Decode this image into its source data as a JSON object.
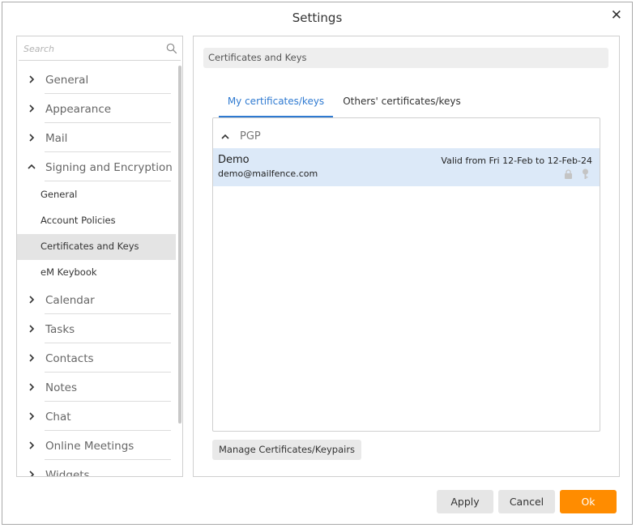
{
  "window": {
    "title": "Settings"
  },
  "sidebar": {
    "search_placeholder": "Search",
    "items": [
      {
        "label": "General",
        "expanded": false
      },
      {
        "label": "Appearance",
        "expanded": false
      },
      {
        "label": "Mail",
        "expanded": false
      },
      {
        "label": "Signing and Encryption",
        "expanded": true,
        "children": [
          {
            "label": "General"
          },
          {
            "label": "Account Policies"
          },
          {
            "label": "Certificates and Keys",
            "selected": true
          },
          {
            "label": "eM Keybook"
          }
        ]
      },
      {
        "label": "Calendar",
        "expanded": false
      },
      {
        "label": "Tasks",
        "expanded": false
      },
      {
        "label": "Contacts",
        "expanded": false
      },
      {
        "label": "Notes",
        "expanded": false
      },
      {
        "label": "Chat",
        "expanded": false
      },
      {
        "label": "Online Meetings",
        "expanded": false
      },
      {
        "label": "Widgets",
        "expanded": false
      }
    ]
  },
  "main": {
    "section_title": "Certificates and Keys",
    "tabs": [
      {
        "label": "My certificates/keys",
        "active": true
      },
      {
        "label": "Others' certificates/keys",
        "active": false
      }
    ],
    "group": {
      "label": "PGP",
      "expanded": true
    },
    "certificates": [
      {
        "name": "Demo",
        "email": "demo@mailfence.com",
        "validity": "Valid from Fri 12-Feb to 12-Feb-24",
        "icons": [
          "lock-icon",
          "key-icon"
        ]
      }
    ],
    "manage_button": "Manage Certificates/Keypairs"
  },
  "footer": {
    "apply": "Apply",
    "cancel": "Cancel",
    "ok": "Ok"
  },
  "colors": {
    "accent": "#2f7ad1",
    "ok_button": "#ff8c00",
    "selected_row": "#dce9f8",
    "selected_nav": "#e4e4e4"
  }
}
